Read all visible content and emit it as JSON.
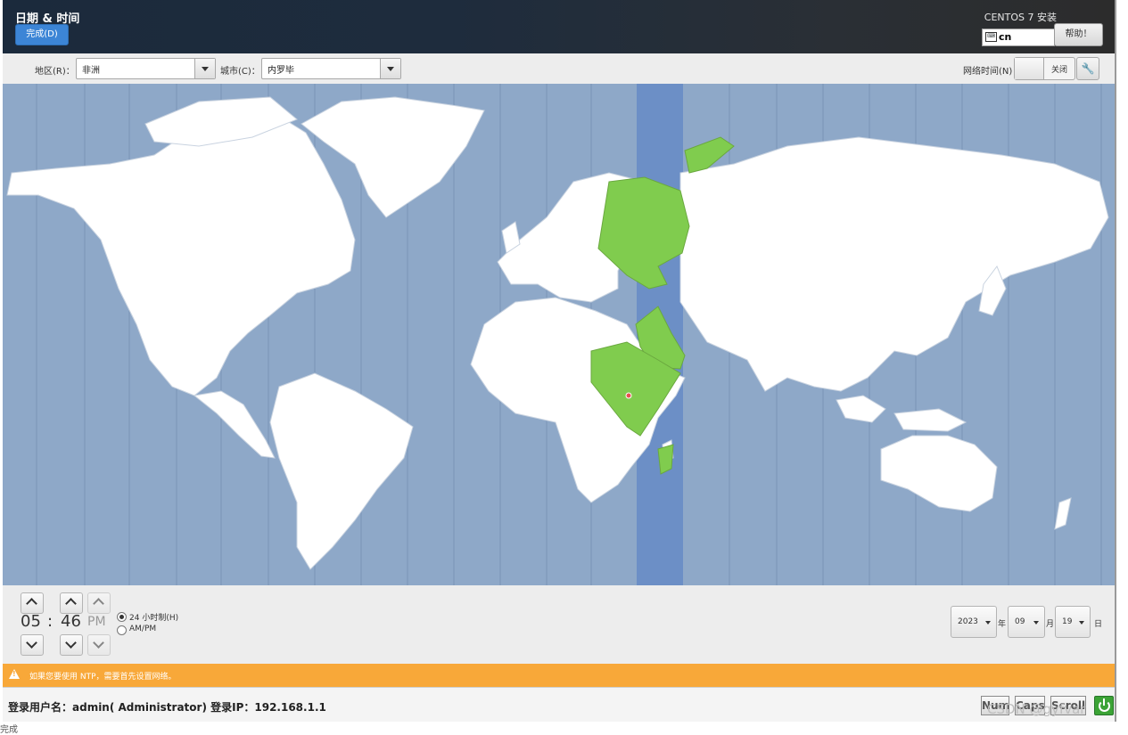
{
  "header": {
    "page_title": "日期 & 时间",
    "done_label": "完成(D)",
    "product_title": "CENTOS 7 安装",
    "keyboard_icon": "keyboard-icon",
    "keyboard_layout": "cn",
    "help_label": "帮助！"
  },
  "toolbar": {
    "region_label": "地区(R)：",
    "region_value": "非洲",
    "city_label": "城市(C)：",
    "city_value": "内罗毕",
    "network_time_label": "网络时间(N)",
    "network_time_state": "关闭",
    "config_icon": "wrench-icon"
  },
  "map": {
    "ocean_color": "#8ea8c8",
    "land_color": "#ffffff",
    "highlight_band_color": "#6c8fc6",
    "highlight_land_color": "#80cc4e",
    "marker_color": "#e85050"
  },
  "time": {
    "hours": "05",
    "separator": ":",
    "minutes": "46",
    "ampm": "PM",
    "format_24h_label": "24 小时制(H)",
    "format_ampm_label": "AM/PM",
    "format_24h_selected": true
  },
  "date": {
    "year": "2023",
    "year_unit": "年",
    "month": "09",
    "month_unit": "月",
    "day": "19",
    "day_unit": "日"
  },
  "warning": {
    "icon": "warning-icon",
    "text": "如果您要使用 NTP，需要首先设置网络。"
  },
  "statusbar": {
    "login_info": "登录用户名：admin( Administrator)    登录IP：192.168.1.1",
    "num_label": "Num",
    "caps_label": "Caps",
    "scroll_label": "Scroll",
    "power_icon": "power-icon"
  },
  "watermark": "CSDN @gyfvar",
  "bottom_status": "完成"
}
